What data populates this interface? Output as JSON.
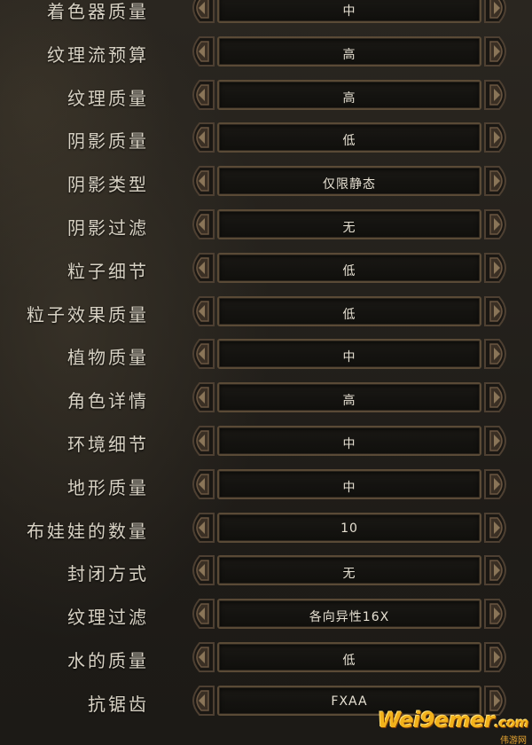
{
  "settings": [
    {
      "label": "着色器质量",
      "value": "中"
    },
    {
      "label": "纹理流预算",
      "value": "高"
    },
    {
      "label": "纹理质量",
      "value": "高"
    },
    {
      "label": "阴影质量",
      "value": "低"
    },
    {
      "label": "阴影类型",
      "value": "仅限静态"
    },
    {
      "label": "阴影过滤",
      "value": "无"
    },
    {
      "label": "粒子细节",
      "value": "低"
    },
    {
      "label": "粒子效果质量",
      "value": "低"
    },
    {
      "label": "植物质量",
      "value": "中"
    },
    {
      "label": "角色详情",
      "value": "高"
    },
    {
      "label": "环境细节",
      "value": "中"
    },
    {
      "label": "地形质量",
      "value": "中"
    },
    {
      "label": "布娃娃的数量",
      "value": "10"
    },
    {
      "label": "封闭方式",
      "value": "无"
    },
    {
      "label": "纹理过滤",
      "value": "各向异性16X"
    },
    {
      "label": "水的质量",
      "value": "低"
    },
    {
      "label": "抗锯齿",
      "value": "FXAA"
    }
  ],
  "watermark": {
    "text": "Wei9emer",
    "domain": ".com",
    "sub": "伟游网"
  },
  "colors": {
    "label_text": "#d8d2c4",
    "value_text": "#e6e0d2",
    "box_border": "#5a4a36",
    "watermark": "#f2b21b"
  },
  "icons": {
    "left_arrow": "ornate-left-arrow-icon",
    "right_arrow": "ornate-right-arrow-icon"
  }
}
